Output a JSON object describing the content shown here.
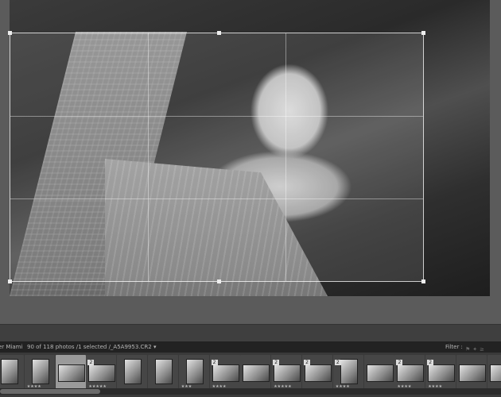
{
  "filmstrip_bar": {
    "source": "er Miami",
    "info": "90 of 118 photos /1 selected /_A5A9953.CR2",
    "dropdown_icon": "chevron-down-icon",
    "filter_label": "Filter :",
    "filter_icons": [
      "flag-icon",
      "star-icon",
      "color-label-icon"
    ]
  },
  "filmstrip": {
    "cells": [
      {
        "kind": "portrait",
        "stack": "",
        "stars": ""
      },
      {
        "kind": "portrait",
        "stack": "",
        "stars": "★★★★"
      },
      {
        "kind": "landscape",
        "stack": "",
        "stars": "",
        "selected": true
      },
      {
        "kind": "landscape",
        "stack": "2",
        "stars": "★★★★★"
      },
      {
        "kind": "portrait",
        "stack": "",
        "stars": ""
      },
      {
        "kind": "portrait",
        "stack": "",
        "stars": ""
      },
      {
        "kind": "portrait",
        "stack": "",
        "stars": "★★★"
      },
      {
        "kind": "landscape",
        "stack": "2",
        "stars": "★★★★"
      },
      {
        "kind": "landscape",
        "stack": "",
        "stars": ""
      },
      {
        "kind": "landscape",
        "stack": "2",
        "stars": "★★★★★"
      },
      {
        "kind": "landscape",
        "stack": "2",
        "stars": ""
      },
      {
        "kind": "portrait",
        "stack": "2",
        "stars": "★★★★"
      },
      {
        "kind": "landscape",
        "stack": "",
        "stars": ""
      },
      {
        "kind": "landscape",
        "stack": "2",
        "stars": "★★★★"
      },
      {
        "kind": "landscape",
        "stack": "2",
        "stars": "★★★★"
      },
      {
        "kind": "landscape",
        "stack": "",
        "stars": ""
      },
      {
        "kind": "landscape",
        "stack": "",
        "stars": ""
      }
    ]
  },
  "scrollbar": {
    "position_fraction": 0.2
  }
}
